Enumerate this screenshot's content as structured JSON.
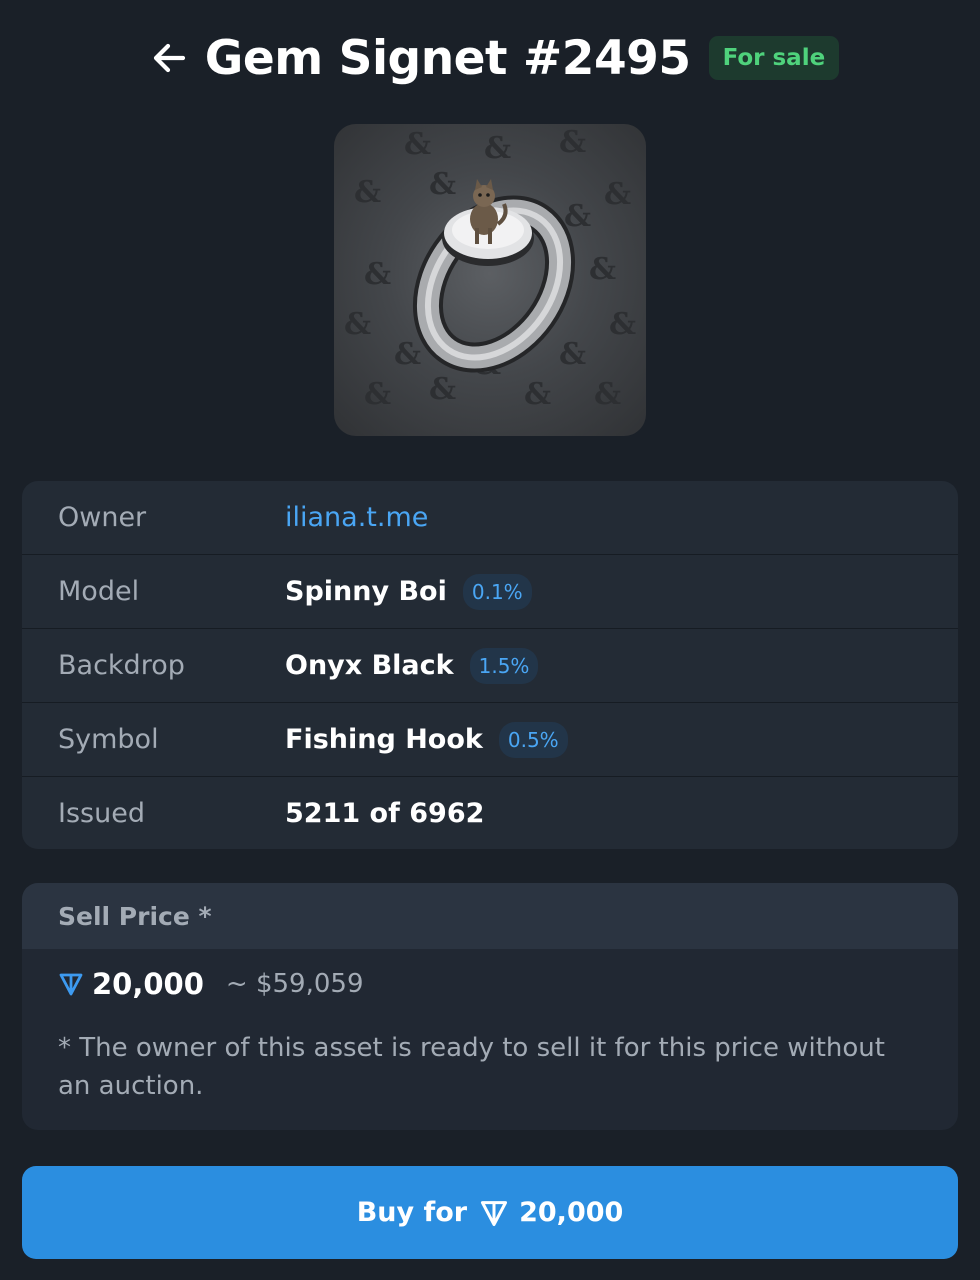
{
  "header": {
    "title": "Gem Signet #2495",
    "status": "For sale"
  },
  "image": {
    "subject": "silver signet ring with a cat on top, pattern of hook symbols on dark backdrop"
  },
  "details": {
    "owner": {
      "label": "Owner",
      "value": "iliana.t.me"
    },
    "model": {
      "label": "Model",
      "value": "Spinny Boi",
      "rarity": "0.1%"
    },
    "backdrop": {
      "label": "Backdrop",
      "value": "Onyx Black",
      "rarity": "1.5%"
    },
    "symbol": {
      "label": "Symbol",
      "value": "Fishing Hook",
      "rarity": "0.5%"
    },
    "issued": {
      "label": "Issued",
      "value": "5211 of 6962"
    }
  },
  "price": {
    "heading": "Sell Price *",
    "amount": "20,000",
    "usd": "~ $59,059",
    "note": "* The owner of this asset is ready to sell it for this price without an auction."
  },
  "buy": {
    "label": "Buy for",
    "amount": "20,000"
  },
  "colors": {
    "background": "#1a2028",
    "card": "#232b35",
    "accent": "#2b8ee0",
    "link": "#4aa6f4",
    "sale_green": "#4fd27c"
  }
}
